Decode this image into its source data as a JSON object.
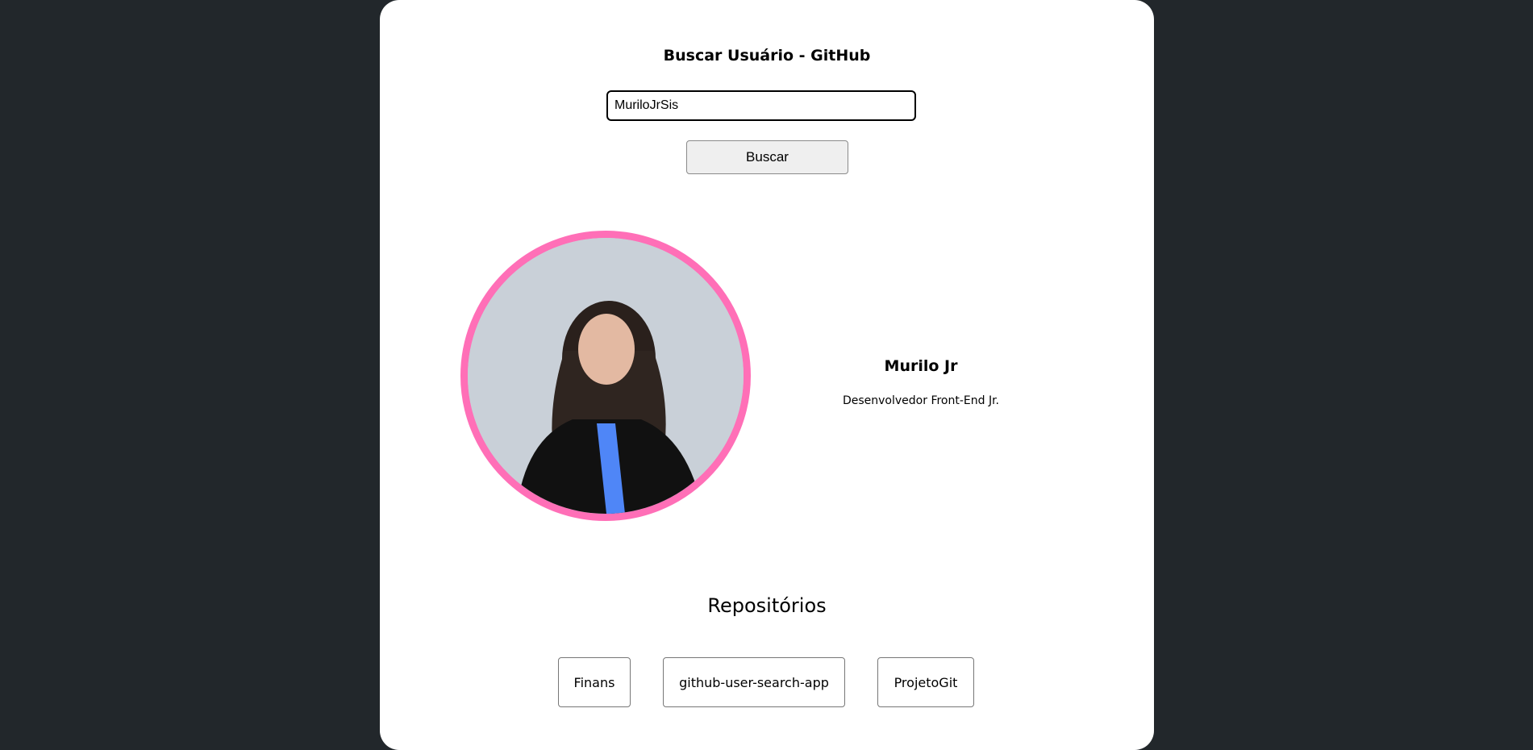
{
  "search": {
    "title": "Buscar Usuário - GitHub",
    "input_value": "MuriloJrSis",
    "button_label": "Buscar"
  },
  "profile": {
    "name": "Murilo Jr",
    "bio": "Desenvolvedor Front-End Jr."
  },
  "repositories": {
    "title": "Repositórios",
    "items": [
      "Finans",
      "github-user-search-app",
      "ProjetoGit"
    ]
  },
  "colors": {
    "background": "#22272b",
    "card": "#ffffff",
    "avatar_border": "#ff6fb7"
  }
}
